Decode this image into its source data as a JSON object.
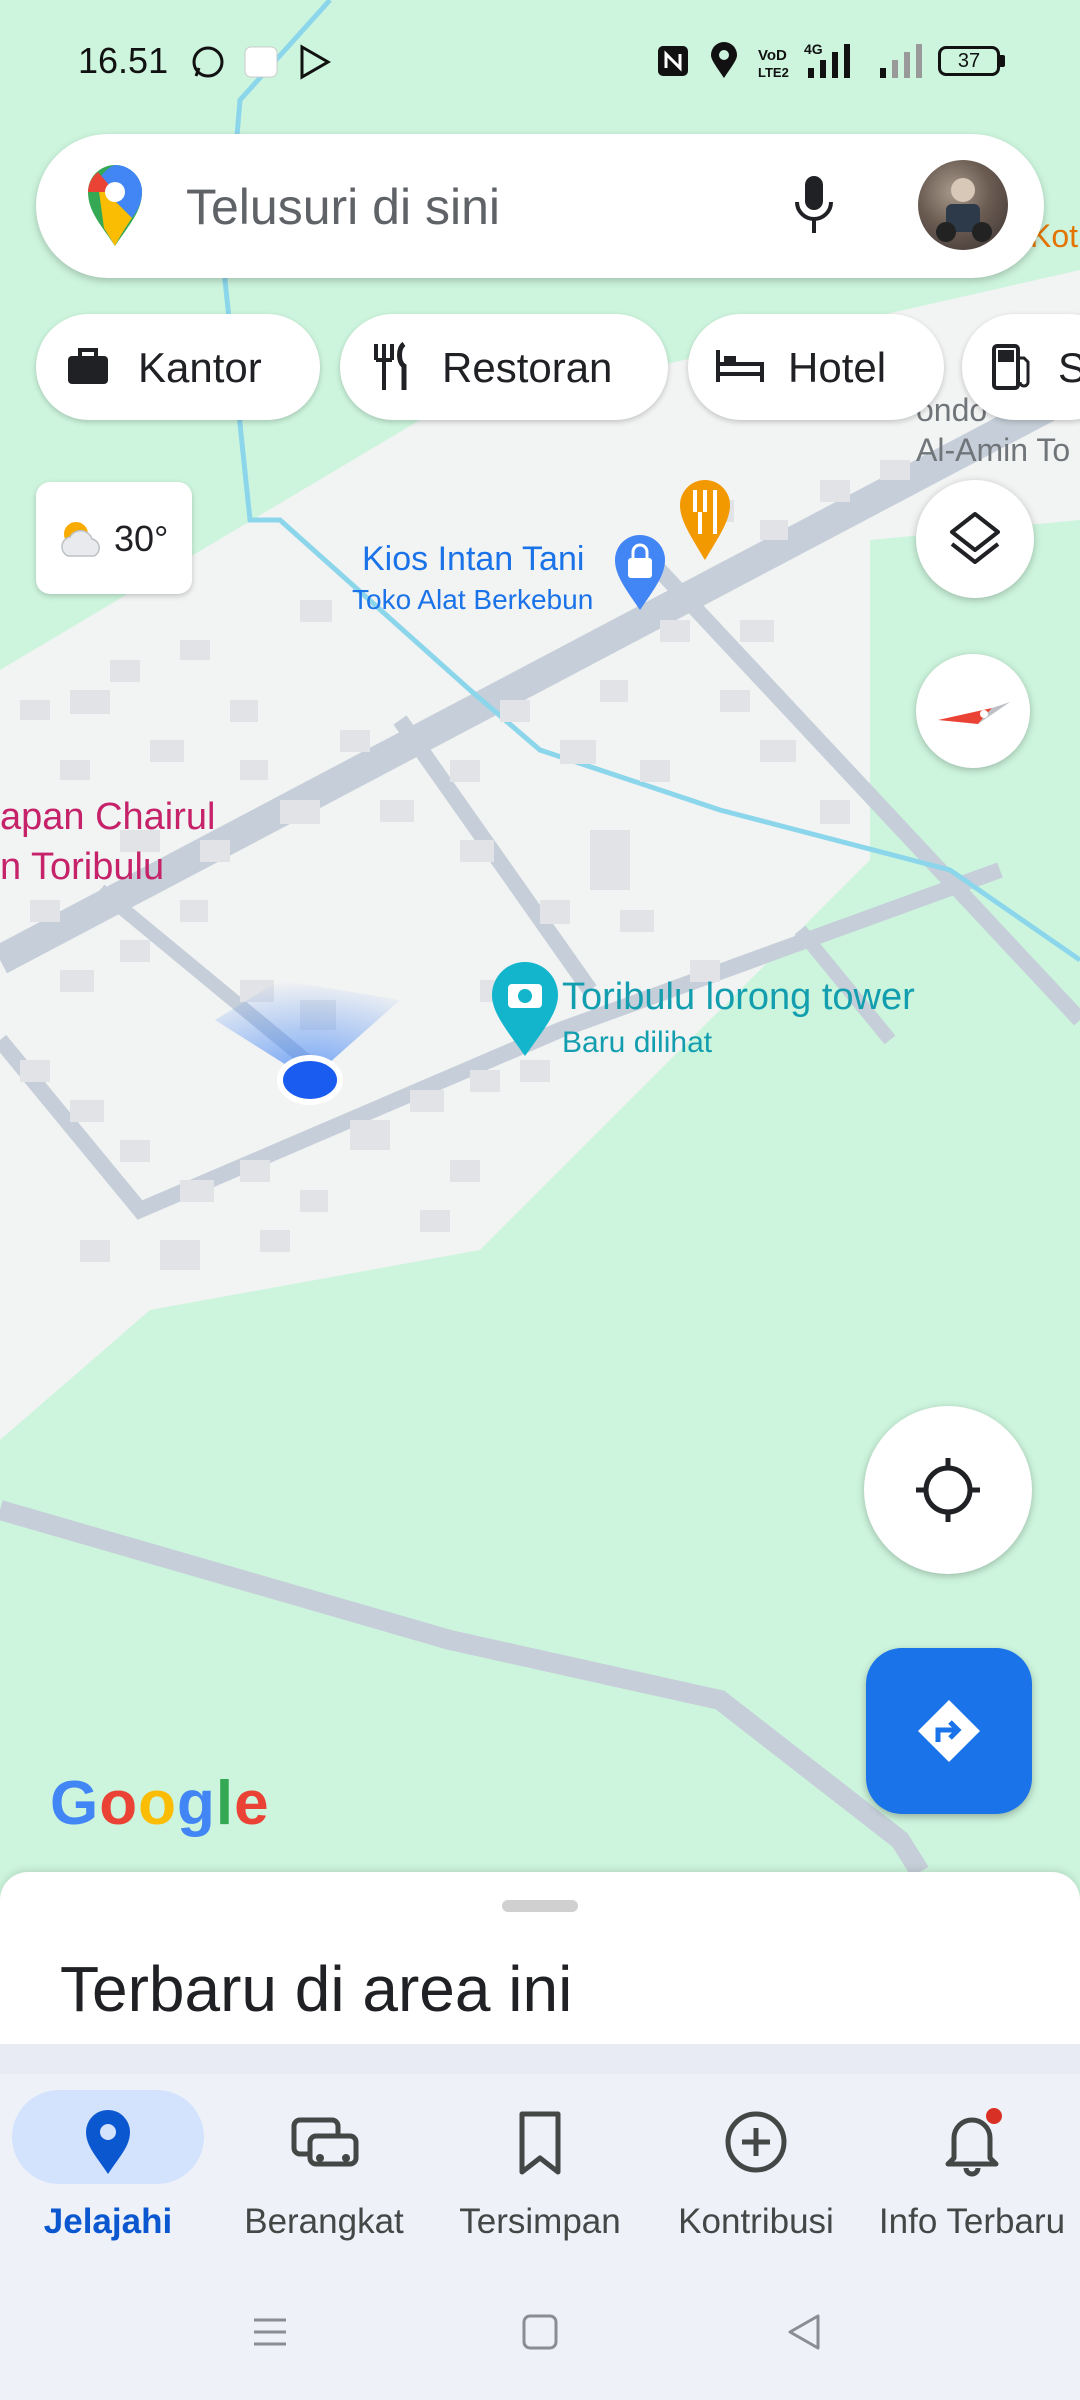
{
  "status_bar": {
    "time": "16.51",
    "battery": "37"
  },
  "search": {
    "placeholder": "Telusuri di sini"
  },
  "chips": [
    {
      "label": "Kantor"
    },
    {
      "label": "Restoran"
    },
    {
      "label": "Hotel"
    },
    {
      "label": "S"
    }
  ],
  "weather": {
    "temperature": "30°"
  },
  "map_labels": {
    "kios_name": "Kios Intan Tani",
    "kios_category": "Toko Alat Berkebun",
    "tower_name": "Toribulu lorong tower",
    "tower_sub": "Baru dilihat",
    "left_name_1": "apan Chairul",
    "left_name_2": "n Toribulu",
    "right_name_1": "ondo",
    "right_name_2": "Al-Amin To",
    "top_right": "Koti"
  },
  "google_logo": "Google",
  "sheet": {
    "title": "Terbaru di area ini"
  },
  "nav": [
    {
      "label": "Jelajahi",
      "icon": "explore-pin-icon",
      "active": true
    },
    {
      "label": "Berangkat",
      "icon": "commute-car-icon",
      "active": false
    },
    {
      "label": "Tersimpan",
      "icon": "bookmark-icon",
      "active": false
    },
    {
      "label": "Kontribusi",
      "icon": "add-circle-icon",
      "active": false
    },
    {
      "label": "Info Terbaru",
      "icon": "bell-icon",
      "active": false
    }
  ],
  "colors": {
    "accent_blue": "#1a73e8",
    "map_green": "#cdf5dd",
    "map_gray": "#f2f3f3",
    "road": "#c6cfd9",
    "river": "#8cd6ec",
    "poi_teal": "#129eaf",
    "poi_blue_text": "#1a73e8",
    "poi_pink_text": "#c5226a",
    "restaurant_orange": "#f29900"
  }
}
